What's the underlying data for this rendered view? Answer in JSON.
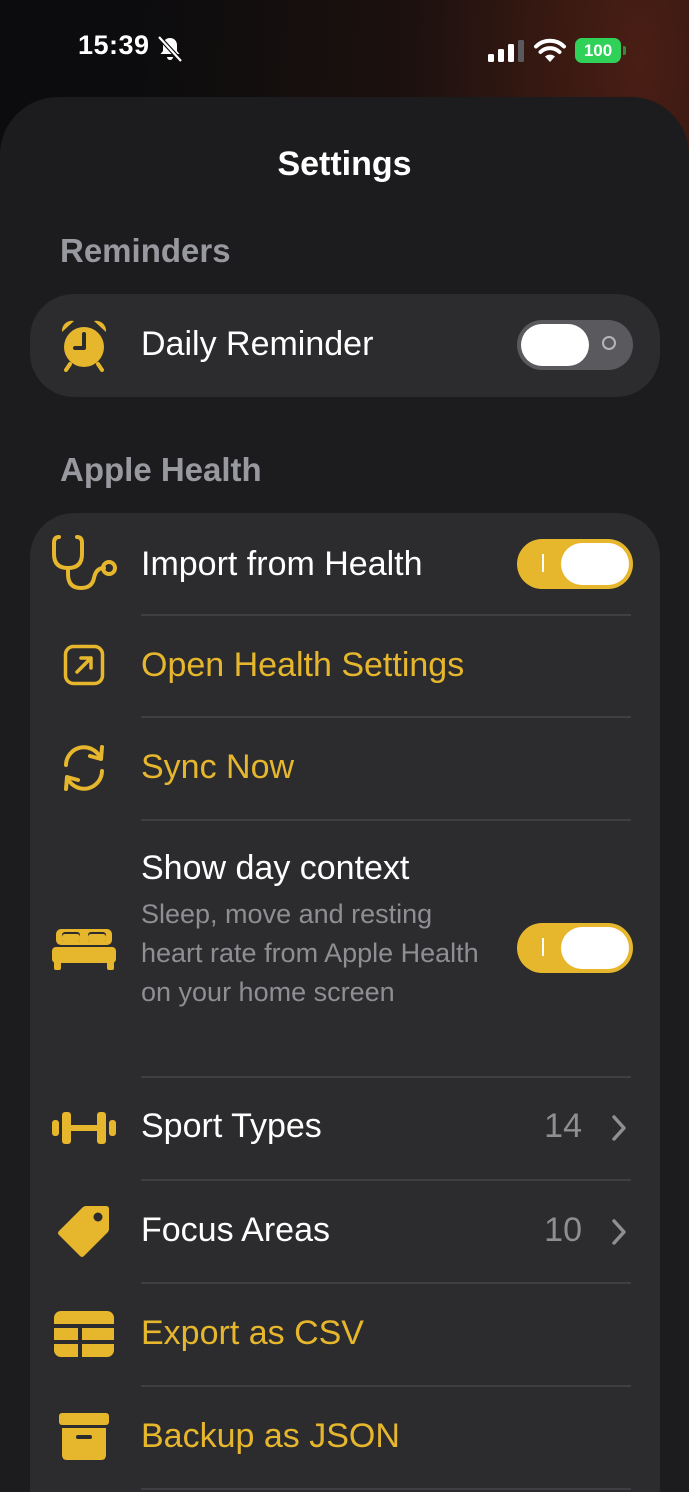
{
  "status_bar": {
    "time": "15:39",
    "battery": "100"
  },
  "colors": {
    "accent": "#e6b62d",
    "sheet_background": "#1c1c1e",
    "group_background": "#2c2c2e",
    "battery_green": "#30d158"
  },
  "settings": {
    "title": "Settings",
    "sections": {
      "reminders": {
        "header": "Reminders",
        "daily_reminder": {
          "label": "Daily Reminder",
          "icon": "alarm-clock-icon",
          "toggle_on": false
        }
      },
      "apple_health": {
        "header": "Apple Health",
        "import_from_health": {
          "label": "Import from Health",
          "icon": "stethoscope-icon",
          "toggle_on": true
        },
        "open_health_settings": {
          "label": "Open Health Settings",
          "icon": "arrow-up-right-square-icon"
        },
        "sync_now": {
          "label": "Sync Now",
          "icon": "sync-arrows-icon"
        },
        "show_day_context": {
          "label": "Show day context",
          "description": "Sleep, move and resting heart rate from Apple Health on your home screen",
          "icon": "bed-icon",
          "toggle_on": true
        },
        "sport_types": {
          "label": "Sport Types",
          "value": "14",
          "icon": "dumbbell-icon"
        },
        "focus_areas": {
          "label": "Focus Areas",
          "value": "10",
          "icon": "tag-icon"
        },
        "export_csv": {
          "label": "Export as CSV",
          "icon": "table-icon"
        },
        "backup_json": {
          "label": "Backup as JSON",
          "icon": "archive-box-icon"
        }
      }
    }
  }
}
